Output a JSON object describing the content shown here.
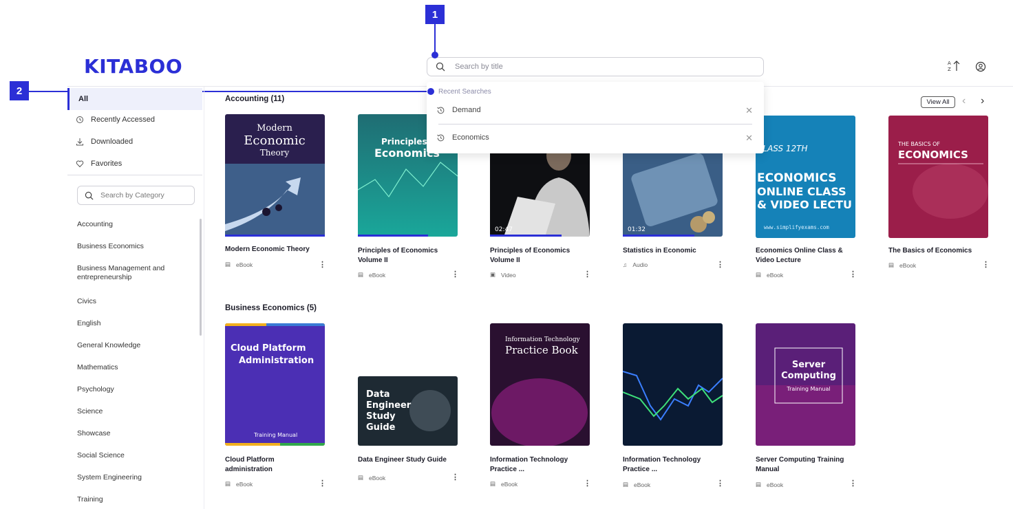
{
  "app": {
    "logo": "KITABOO"
  },
  "search": {
    "placeholder": "Search by title",
    "recent_heading": "Recent Searches",
    "recent": [
      "Demand",
      "Economics"
    ]
  },
  "callouts": [
    "1",
    "2"
  ],
  "sidebar": {
    "nav": [
      "All",
      "Recently Accessed",
      "Downloaded",
      "Favorites"
    ],
    "category_search_placeholder": "Search by Category",
    "categories": [
      "Accounting",
      "Business Economics",
      "Business Management and entrepreneurship",
      "Civics",
      "English",
      "General Knowledge",
      "Mathematics",
      "Psychology",
      "Science",
      "Showcase",
      "Social Science",
      "System Engineering",
      "Training"
    ]
  },
  "sections": [
    {
      "title": "Accounting (11)",
      "view_all": "View All",
      "books": [
        {
          "title": "Modern Economic Theory",
          "type": "eBook",
          "cover": {
            "lines": [
              "Modern",
              "Economic",
              "Theory"
            ]
          },
          "progress": 1.0
        },
        {
          "title": "Principles of Economics Volume II",
          "type": "eBook",
          "cover": {
            "lines": [
              "Principles",
              "Economics"
            ]
          },
          "progress": 0.7
        },
        {
          "title": "Principles of Economics Volume II",
          "type": "Video",
          "cover": {
            "duration": "02:47"
          },
          "progress": 0.72
        },
        {
          "title": "Statistics in Economic",
          "type": "Audio",
          "cover": {
            "duration": "01:32"
          },
          "progress": 0.72
        },
        {
          "title": "Economics Online Class & Video Lecture",
          "type": "eBook",
          "cover": {
            "lines": [
              "CLASS 12TH",
              "ECONOMICS",
              "ONLINE CLASS",
              "& VIDEO LECTU",
              "www.simplifyexams.com"
            ]
          }
        },
        {
          "title": "The Basics of Economics",
          "type": "eBook",
          "cover": {
            "lines": [
              "THE BASICS OF",
              "ECONOMICS"
            ]
          }
        }
      ]
    },
    {
      "title": "Business Economics (5)",
      "books": [
        {
          "title": "Cloud Platform administration",
          "type": "eBook",
          "cover": {
            "lines": [
              "Cloud Platform",
              "Administration",
              "Training Manual"
            ]
          }
        },
        {
          "title": "Data Engineer Study Guide",
          "type": "eBook",
          "cover": {
            "lines": [
              "Data",
              "Engineer",
              "Study",
              "Guide"
            ]
          }
        },
        {
          "title": "Information Technology Practice ...",
          "type": "eBook",
          "cover": {
            "lines": [
              "Information Technology",
              "Practice Book"
            ]
          }
        },
        {
          "title": "Information Technology Practice ...",
          "type": "eBook",
          "cover": {}
        },
        {
          "title": "Server Computing Training Manual",
          "type": "eBook",
          "cover": {
            "lines": [
              "Server",
              "Computing",
              "Training Manual"
            ]
          }
        }
      ]
    }
  ],
  "colors": {
    "accent": "#2b2fd6"
  },
  "icons": [
    "search-icon",
    "sort-az-icon",
    "user-icon",
    "history-icon",
    "close-icon",
    "recent-icon",
    "download-icon",
    "heart-icon",
    "ebook-icon",
    "video-icon",
    "audio-icon",
    "kebab-icon",
    "chevron-left-icon",
    "chevron-right-icon"
  ]
}
